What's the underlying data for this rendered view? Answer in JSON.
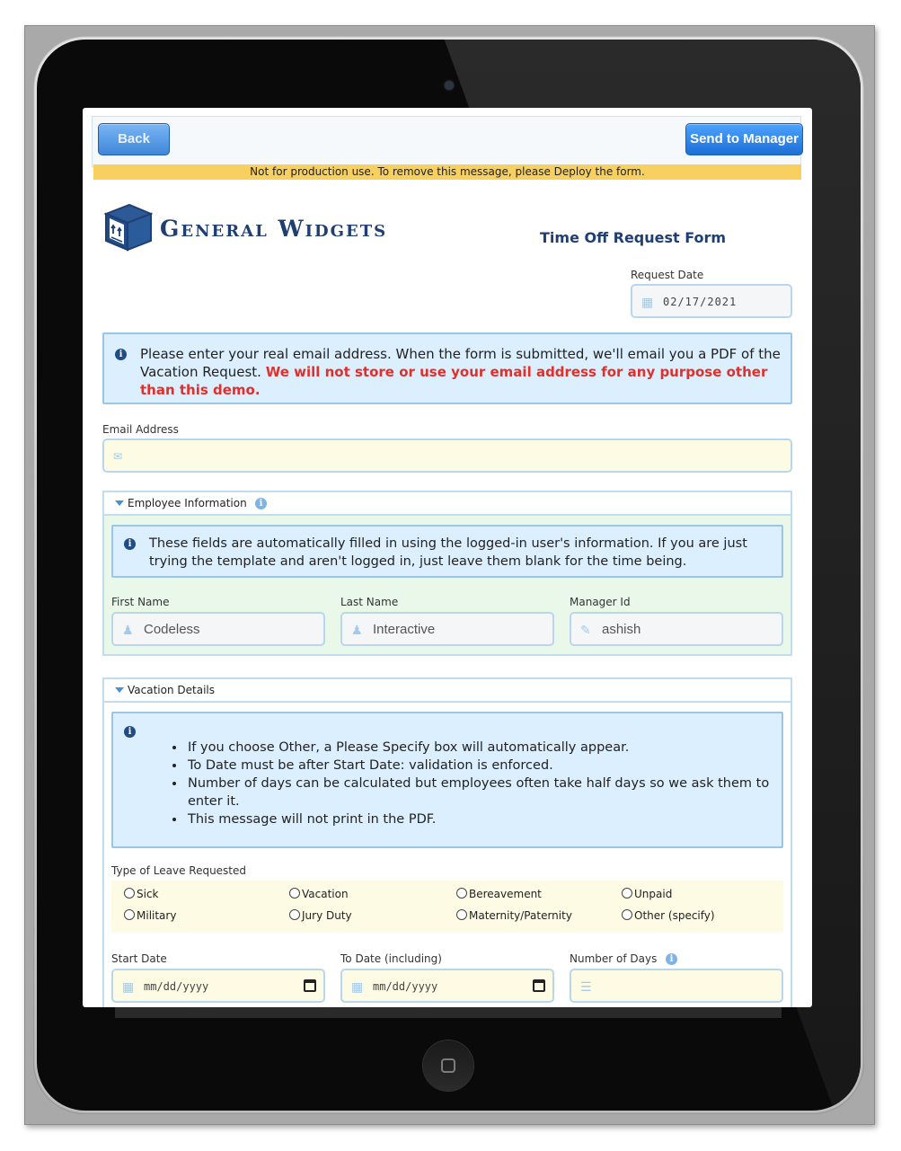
{
  "toolbar": {
    "back_label": "Back",
    "send_label": "Send to Manager"
  },
  "warning": "Not for production use. To remove this message, please Deploy the form.",
  "logo": {
    "text": "General Widgets"
  },
  "form_title": "Time Off Request Form",
  "request_date": {
    "label": "Request Date",
    "value": "02/17/2021"
  },
  "email_notice": {
    "text": "Please enter your real email address. When the form is submitted, we'll email you a PDF of the Vacation Request.",
    "warning": "We will not store or use your email address for any purpose other than this demo."
  },
  "email": {
    "label": "Email Address",
    "value": ""
  },
  "employee_section": {
    "title": "Employee Information",
    "notice": "These fields are automatically filled in using the logged-in user's information. If you are just trying the template and aren't logged in, just leave them blank for the time being.",
    "first_name": {
      "label": "First Name",
      "value": "Codeless"
    },
    "last_name": {
      "label": "Last Name",
      "value": "Interactive"
    },
    "manager_id": {
      "label": "Manager Id",
      "value": "ashish"
    }
  },
  "vacation_section": {
    "title": "Vacation Details",
    "bullets": [
      "If you choose Other, a Please Specify box will automatically appear.",
      "To Date must be after Start Date: validation is enforced.",
      "Number of days can be calculated but employees often take half days so we ask them to enter it.",
      "This message will not print in the PDF."
    ],
    "leave_type_label": "Type of Leave Requested",
    "leave_types": [
      "Sick",
      "Vacation",
      "Bereavement",
      "Unpaid",
      "Military",
      "Jury Duty",
      "Maternity/Paternity",
      "Other (specify)"
    ],
    "start_date": {
      "label": "Start Date",
      "placeholder": "mm/dd/yyyy"
    },
    "to_date": {
      "label": "To Date (including)",
      "placeholder": "mm/dd/yyyy"
    },
    "num_days": {
      "label": "Number of Days",
      "value": ""
    }
  },
  "colors": {
    "accent": "#1c6fd6",
    "warning_bar": "#f8d060",
    "warning_text": "#e0302a",
    "brand_navy": "#1f3f73"
  }
}
